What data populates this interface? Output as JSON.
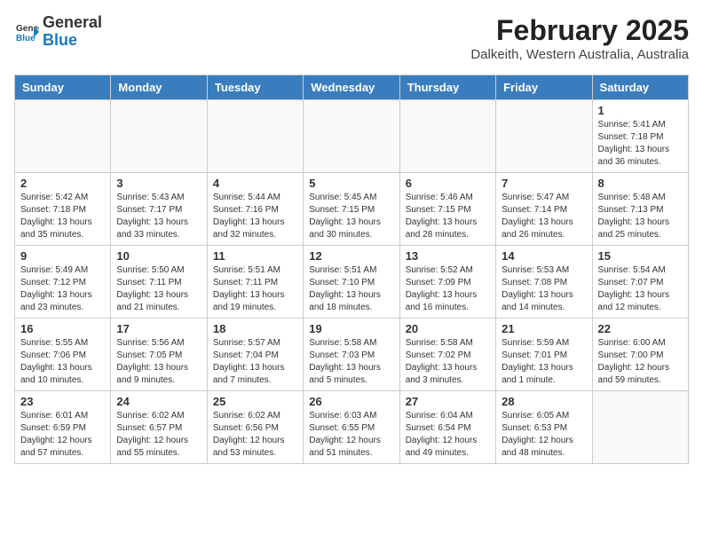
{
  "logo": {
    "line1": "General",
    "line2": "Blue",
    "icon": "▶"
  },
  "title": "February 2025",
  "subtitle": "Dalkeith, Western Australia, Australia",
  "headers": [
    "Sunday",
    "Monday",
    "Tuesday",
    "Wednesday",
    "Thursday",
    "Friday",
    "Saturday"
  ],
  "weeks": [
    [
      {
        "day": "",
        "info": ""
      },
      {
        "day": "",
        "info": ""
      },
      {
        "day": "",
        "info": ""
      },
      {
        "day": "",
        "info": ""
      },
      {
        "day": "",
        "info": ""
      },
      {
        "day": "",
        "info": ""
      },
      {
        "day": "1",
        "info": "Sunrise: 5:41 AM\nSunset: 7:18 PM\nDaylight: 13 hours\nand 36 minutes."
      }
    ],
    [
      {
        "day": "2",
        "info": "Sunrise: 5:42 AM\nSunset: 7:18 PM\nDaylight: 13 hours\nand 35 minutes."
      },
      {
        "day": "3",
        "info": "Sunrise: 5:43 AM\nSunset: 7:17 PM\nDaylight: 13 hours\nand 33 minutes."
      },
      {
        "day": "4",
        "info": "Sunrise: 5:44 AM\nSunset: 7:16 PM\nDaylight: 13 hours\nand 32 minutes."
      },
      {
        "day": "5",
        "info": "Sunrise: 5:45 AM\nSunset: 7:15 PM\nDaylight: 13 hours\nand 30 minutes."
      },
      {
        "day": "6",
        "info": "Sunrise: 5:46 AM\nSunset: 7:15 PM\nDaylight: 13 hours\nand 28 minutes."
      },
      {
        "day": "7",
        "info": "Sunrise: 5:47 AM\nSunset: 7:14 PM\nDaylight: 13 hours\nand 26 minutes."
      },
      {
        "day": "8",
        "info": "Sunrise: 5:48 AM\nSunset: 7:13 PM\nDaylight: 13 hours\nand 25 minutes."
      }
    ],
    [
      {
        "day": "9",
        "info": "Sunrise: 5:49 AM\nSunset: 7:12 PM\nDaylight: 13 hours\nand 23 minutes."
      },
      {
        "day": "10",
        "info": "Sunrise: 5:50 AM\nSunset: 7:11 PM\nDaylight: 13 hours\nand 21 minutes."
      },
      {
        "day": "11",
        "info": "Sunrise: 5:51 AM\nSunset: 7:11 PM\nDaylight: 13 hours\nand 19 minutes."
      },
      {
        "day": "12",
        "info": "Sunrise: 5:51 AM\nSunset: 7:10 PM\nDaylight: 13 hours\nand 18 minutes."
      },
      {
        "day": "13",
        "info": "Sunrise: 5:52 AM\nSunset: 7:09 PM\nDaylight: 13 hours\nand 16 minutes."
      },
      {
        "day": "14",
        "info": "Sunrise: 5:53 AM\nSunset: 7:08 PM\nDaylight: 13 hours\nand 14 minutes."
      },
      {
        "day": "15",
        "info": "Sunrise: 5:54 AM\nSunset: 7:07 PM\nDaylight: 13 hours\nand 12 minutes."
      }
    ],
    [
      {
        "day": "16",
        "info": "Sunrise: 5:55 AM\nSunset: 7:06 PM\nDaylight: 13 hours\nand 10 minutes."
      },
      {
        "day": "17",
        "info": "Sunrise: 5:56 AM\nSunset: 7:05 PM\nDaylight: 13 hours\nand 9 minutes."
      },
      {
        "day": "18",
        "info": "Sunrise: 5:57 AM\nSunset: 7:04 PM\nDaylight: 13 hours\nand 7 minutes."
      },
      {
        "day": "19",
        "info": "Sunrise: 5:58 AM\nSunset: 7:03 PM\nDaylight: 13 hours\nand 5 minutes."
      },
      {
        "day": "20",
        "info": "Sunrise: 5:58 AM\nSunset: 7:02 PM\nDaylight: 13 hours\nand 3 minutes."
      },
      {
        "day": "21",
        "info": "Sunrise: 5:59 AM\nSunset: 7:01 PM\nDaylight: 13 hours\nand 1 minute."
      },
      {
        "day": "22",
        "info": "Sunrise: 6:00 AM\nSunset: 7:00 PM\nDaylight: 12 hours\nand 59 minutes."
      }
    ],
    [
      {
        "day": "23",
        "info": "Sunrise: 6:01 AM\nSunset: 6:59 PM\nDaylight: 12 hours\nand 57 minutes."
      },
      {
        "day": "24",
        "info": "Sunrise: 6:02 AM\nSunset: 6:57 PM\nDaylight: 12 hours\nand 55 minutes."
      },
      {
        "day": "25",
        "info": "Sunrise: 6:02 AM\nSunset: 6:56 PM\nDaylight: 12 hours\nand 53 minutes."
      },
      {
        "day": "26",
        "info": "Sunrise: 6:03 AM\nSunset: 6:55 PM\nDaylight: 12 hours\nand 51 minutes."
      },
      {
        "day": "27",
        "info": "Sunrise: 6:04 AM\nSunset: 6:54 PM\nDaylight: 12 hours\nand 49 minutes."
      },
      {
        "day": "28",
        "info": "Sunrise: 6:05 AM\nSunset: 6:53 PM\nDaylight: 12 hours\nand 48 minutes."
      },
      {
        "day": "",
        "info": ""
      }
    ]
  ]
}
